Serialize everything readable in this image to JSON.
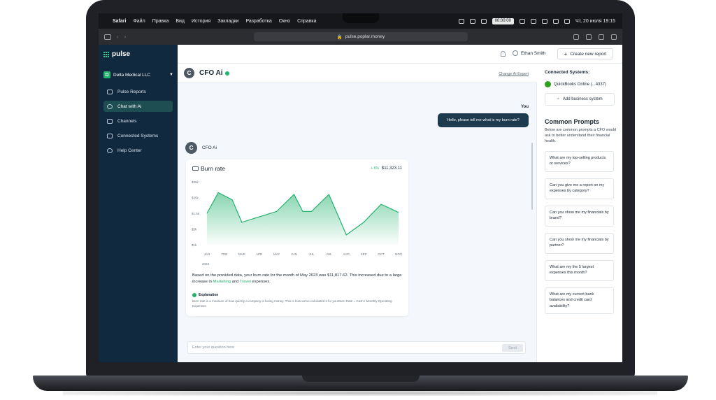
{
  "menubar": {
    "items": [
      "Safari",
      "Файл",
      "Правка",
      "Вид",
      "История",
      "Закладки",
      "Разработка",
      "Окно",
      "Справка"
    ],
    "timer": "00:00:00",
    "datetime": "Чт, 20 июля  19:15"
  },
  "browser": {
    "url": "pulse.poplar.money"
  },
  "sidebar": {
    "logo": "pulse",
    "company": {
      "badge": "D",
      "name": "Delta Medical LLC"
    },
    "items": [
      {
        "label": "Pulse Reports",
        "icon": "reports-icon"
      },
      {
        "label": "Chat with Ai",
        "icon": "chat-icon",
        "active": true
      },
      {
        "label": "Channels",
        "icon": "channels-icon"
      },
      {
        "label": "Connected Systems",
        "icon": "systems-icon"
      },
      {
        "label": "Help Center",
        "icon": "help-icon"
      }
    ]
  },
  "topbar": {
    "user": "Ethan Smith",
    "create_label": "Create new report"
  },
  "chat": {
    "avatar_letter": "C",
    "title": "CFO Ai",
    "change_link": "Change Ai Expert",
    "you_label": "You",
    "user_message": "Hello, please tell me what is my burn rate?",
    "ai_name": "CFO Ai",
    "input_placeholder": "Enter your question here",
    "send_label": "Send"
  },
  "card": {
    "title": "Burn rate",
    "change_pct": "+ 6%",
    "amount": "$11,323.11",
    "year": "2023",
    "text_pre": "Based on the provided data, your burn rate for the month of May 2023 was $11,817.62. This increased due to a large increase in ",
    "tag1": "Marketing",
    "text_mid": " and ",
    "tag2": "Travel",
    "text_post": " expenses.",
    "explain_title": "Explanation",
    "explain_text": "Burn rate is a measure of how quickly a company is losing money. This is how we've calculated it for you:Burn Rate = Cash / Monthly Operating Expenses"
  },
  "chart_data": {
    "type": "area",
    "categories": [
      "JAN",
      "FEB",
      "MAR",
      "APR",
      "MAY",
      "JUN",
      "JUL",
      "JUL",
      "AUG",
      "SEP",
      "OCT",
      "NOV"
    ],
    "values": [
      17.5,
      29,
      25,
      12.5,
      15.5,
      18.5,
      28,
      18.5,
      18.5,
      28,
      5.5,
      12.5,
      22.5,
      18
    ],
    "x_positions": [
      0,
      0.65,
      1.45,
      2.0,
      3.0,
      4.0,
      5.0,
      5.5,
      6.0,
      7.0,
      8.0,
      9.0,
      10.0,
      11.0
    ],
    "yticks": [
      "$1k",
      "$5k",
      "$1.5k",
      "$25k",
      "$35k"
    ],
    "color": "#23b26d"
  },
  "right_panel": {
    "connected_title": "Connected Systems:",
    "system": "QuickBooks Online (...4337)",
    "add_label": "Add business system",
    "prompts_title": "Common Prompts",
    "prompts_sub": "Below are common prompts a CFO would ask to better understand their financial health.",
    "prompts": [
      "What are my top-selling products or services?",
      "Can you give me a report on my expenses by category?",
      "Can you show me my financials by brand?",
      "Can you show me my financials by partner?",
      "What are my the 5 largest expenses this month?",
      "What are my current bank balances and credit card availability?"
    ]
  }
}
